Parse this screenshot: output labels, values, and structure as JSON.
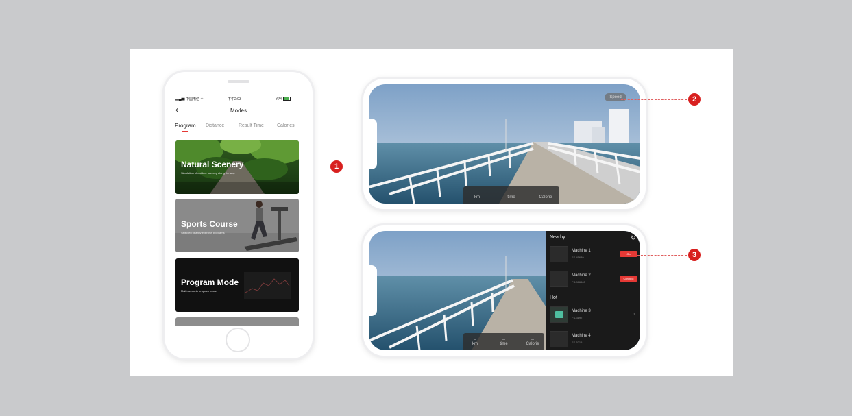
{
  "portrait": {
    "status": {
      "carrier": "中国电信",
      "time": "下午2:03",
      "battery": "80%"
    },
    "title": "Modes",
    "tabs": [
      "Program",
      "Distance",
      "Result Time",
      "Calories"
    ],
    "cards": [
      {
        "title": "Natural Scenery",
        "subtitle": "Simulation of outdoor scenery along the way"
      },
      {
        "title": "Sports Course",
        "subtitle": "Selected healthy exercise programs"
      },
      {
        "title": "Program Mode",
        "subtitle": "Multi-scenario program mode"
      }
    ]
  },
  "scenery_view": {
    "speed_button": "Speed",
    "controls": [
      {
        "value": "--",
        "label": "km"
      },
      {
        "value": "--",
        "label": "time"
      },
      {
        "value": "--",
        "label": "Calorie"
      }
    ]
  },
  "machine_panel": {
    "nearby_label": "Nearby",
    "hot_label": "Hot",
    "machines": [
      {
        "name": "Machine 1",
        "id": "FS-45689",
        "action": "Go"
      },
      {
        "name": "Machine 2",
        "id": "FS-986563",
        "action": "Connect"
      },
      {
        "name": "Machine 3",
        "id": "FS-3192",
        "action": ""
      },
      {
        "name": "Machine 4",
        "id": "FS-5215",
        "action": ""
      }
    ]
  },
  "callouts": [
    "1",
    "2",
    "3"
  ],
  "colors": {
    "accent": "#d8201f",
    "background": "#c9cacc",
    "card": "#ffffff"
  }
}
